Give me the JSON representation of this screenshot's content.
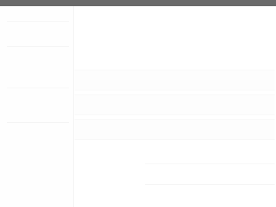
{
  "window": {
    "titlebar_color": "#6a6a6a",
    "background_color": "#ffffff"
  }
}
